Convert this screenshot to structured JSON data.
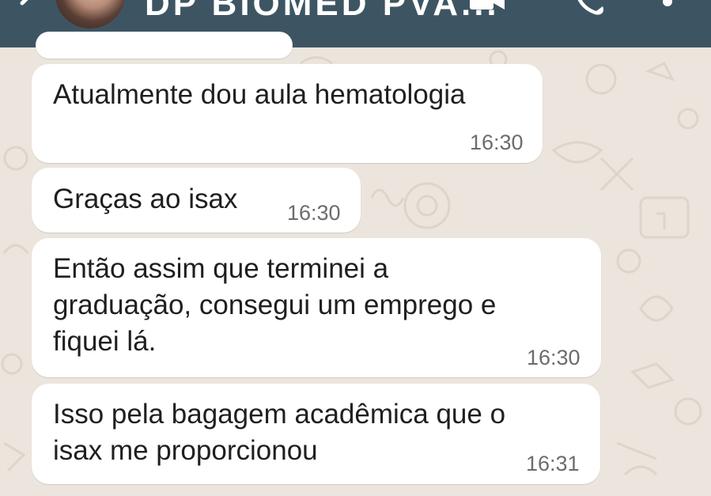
{
  "header": {
    "contact_name": "DP BIOMED PVA...",
    "background_color": "#3d5563"
  },
  "icons": {
    "back": "back-arrow-icon",
    "video": "video-call-icon",
    "phone": "phone-call-icon",
    "menu": "more-options-icon"
  },
  "messages": [
    {
      "lines": [
        "Atualmente dou aula hematologia"
      ],
      "time": "16:30"
    },
    {
      "lines": [
        "Graças ao isax"
      ],
      "time": "16:30"
    },
    {
      "lines": [
        "Então assim que terminei a",
        "graduação, consegui um emprego e",
        "fiquei lá."
      ],
      "time": "16:30"
    },
    {
      "lines": [
        "Isso pela bagagem acadêmica que o",
        "isax me proporcionou"
      ],
      "time": "16:31"
    }
  ],
  "colors": {
    "chat_background": "#ece5dd",
    "bubble": "#ffffff",
    "timestamp": "#6c6c6c"
  }
}
